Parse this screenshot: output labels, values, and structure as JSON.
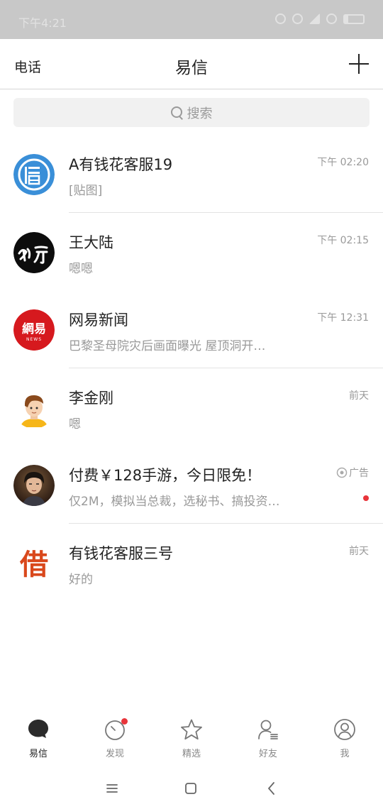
{
  "status_bar": {
    "time": "下午4:21"
  },
  "header": {
    "left_link": "电话",
    "title": "易信",
    "add_icon": "plus-icon"
  },
  "search": {
    "placeholder": "搜索",
    "icon": "search-icon"
  },
  "chats": [
    {
      "name": "A有钱花客服19",
      "preview": "[贴图]",
      "time": "下午 02:20",
      "ad": false,
      "unread_dot": false
    },
    {
      "name": "王大陆",
      "preview": "嗯嗯",
      "time": "下午 02:15",
      "ad": false,
      "unread_dot": false
    },
    {
      "name": "网易新闻",
      "preview": "巴黎圣母院灾后画面曝光 屋顶洞开…",
      "time": "下午 12:31",
      "ad": false,
      "unread_dot": false,
      "avatar_text": "網易",
      "avatar_subtext": "NEWS"
    },
    {
      "name": "李金刚",
      "preview": "嗯",
      "time": "前天",
      "ad": false,
      "unread_dot": false
    },
    {
      "name": "付费￥128手游，今日限免！",
      "preview": "仅2M，模拟当总裁，选秘书、搞投资…",
      "time": "广告",
      "ad": true,
      "unread_dot": true
    },
    {
      "name": "有钱花客服三号",
      "preview": "好的",
      "time": "前天",
      "ad": false,
      "unread_dot": false,
      "avatar_text": "借"
    }
  ],
  "tabs": [
    {
      "label": "易信",
      "icon": "chat-bubble-icon",
      "active": true,
      "badge": false
    },
    {
      "label": "发现",
      "icon": "compass-icon",
      "active": false,
      "badge": true
    },
    {
      "label": "精选",
      "icon": "star-icon",
      "active": false,
      "badge": false
    },
    {
      "label": "好友",
      "icon": "contacts-icon",
      "active": false,
      "badge": false
    },
    {
      "label": "我",
      "icon": "profile-icon",
      "active": false,
      "badge": false
    }
  ],
  "nav": {
    "menu": "menu-icon",
    "home": "home-icon",
    "back": "back-icon"
  },
  "colors": {
    "accent_red": "#e8343a",
    "avatar_blue": "#3a8fd8",
    "netease_red": "#d6191e",
    "borrow_orange": "#d9481c"
  }
}
